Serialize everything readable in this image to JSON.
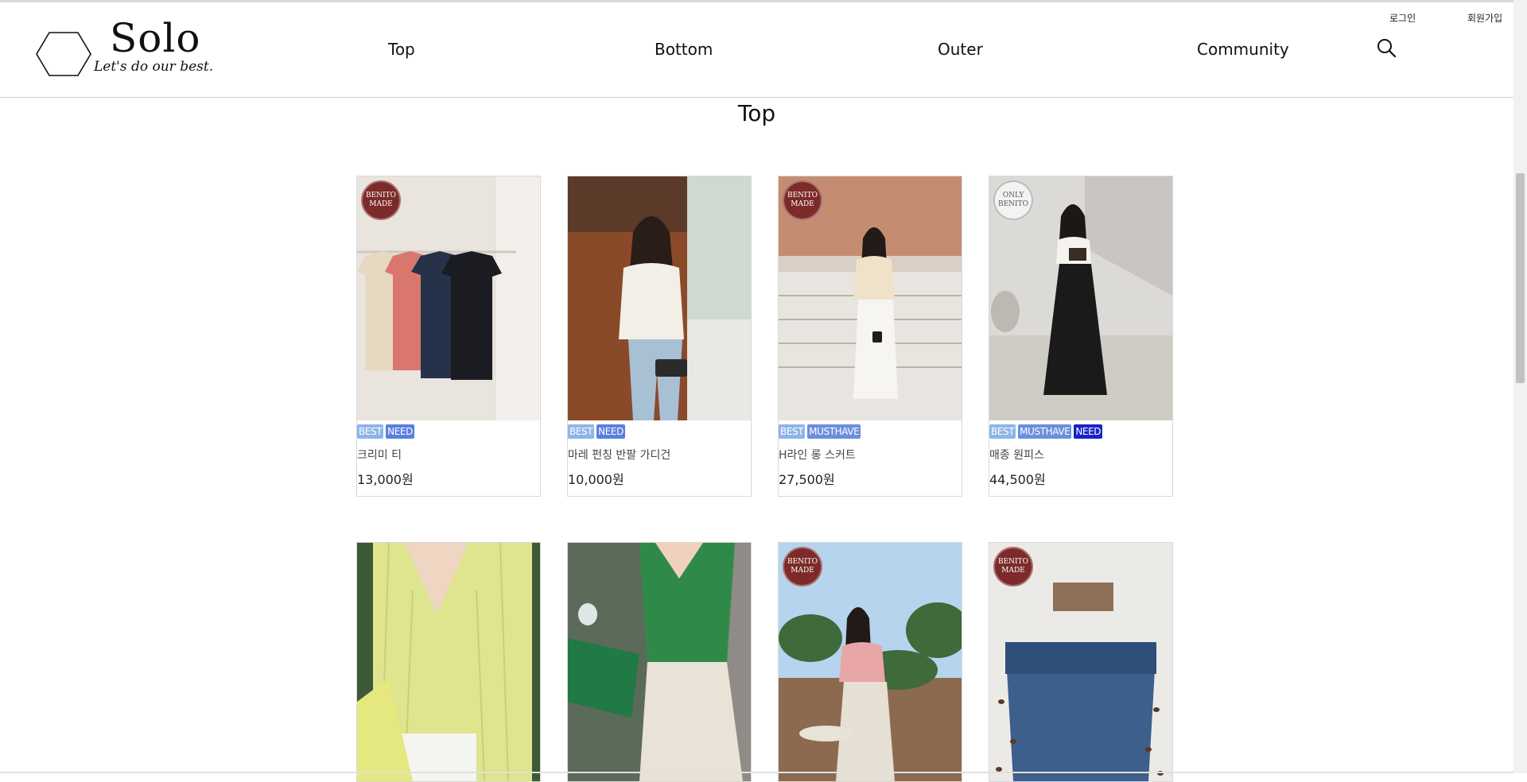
{
  "brand": {
    "name": "Solo",
    "tagline": "Let's do our best."
  },
  "nav": [
    {
      "label": "Top"
    },
    {
      "label": "Bottom"
    },
    {
      "label": "Outer"
    },
    {
      "label": "Community"
    }
  ],
  "util": {
    "login": "로그인",
    "signup": "회원가입"
  },
  "section_title": "Top",
  "colors": {
    "tag_best": "#8fb4e8",
    "tag_need": "#5a7fe0",
    "tag_musthave": "#6a8fdc",
    "tag_need_dark": "#1a22c9",
    "seal_red": "#7d2a2a"
  },
  "products": [
    {
      "seal": "BENITO MADE",
      "tags": [
        "BEST",
        "NEED"
      ],
      "name": "크리미 티",
      "price": "13,000원"
    },
    {
      "seal": "",
      "tags": [
        "BEST",
        "NEED"
      ],
      "name": "마레 펀칭 반팔 가디건",
      "price": "10,000원"
    },
    {
      "seal": "BENITO MADE",
      "tags": [
        "BEST",
        "MUSTHAVE"
      ],
      "name": "H라인 롱 스커트",
      "price": "27,500원"
    },
    {
      "seal": "ONLY BENITO",
      "tags": [
        "BEST",
        "MUSTHAVE",
        "NEED"
      ],
      "name": "매종 원피스",
      "price": "44,500원"
    },
    {
      "seal": "",
      "tags": [],
      "name": "",
      "price": ""
    },
    {
      "seal": "",
      "tags": [],
      "name": "",
      "price": ""
    },
    {
      "seal": "BENITO MADE",
      "tags": [],
      "name": "",
      "price": ""
    },
    {
      "seal": "BENITO MADE",
      "tags": [],
      "name": "",
      "price": ""
    }
  ],
  "seal_lines": {
    "benito_made": [
      "BENITO",
      "MADE"
    ],
    "only_benito": [
      "ONLY",
      "BENITO"
    ]
  },
  "icons": {
    "search": "search-icon",
    "logo": "hexagon-logo-icon"
  }
}
